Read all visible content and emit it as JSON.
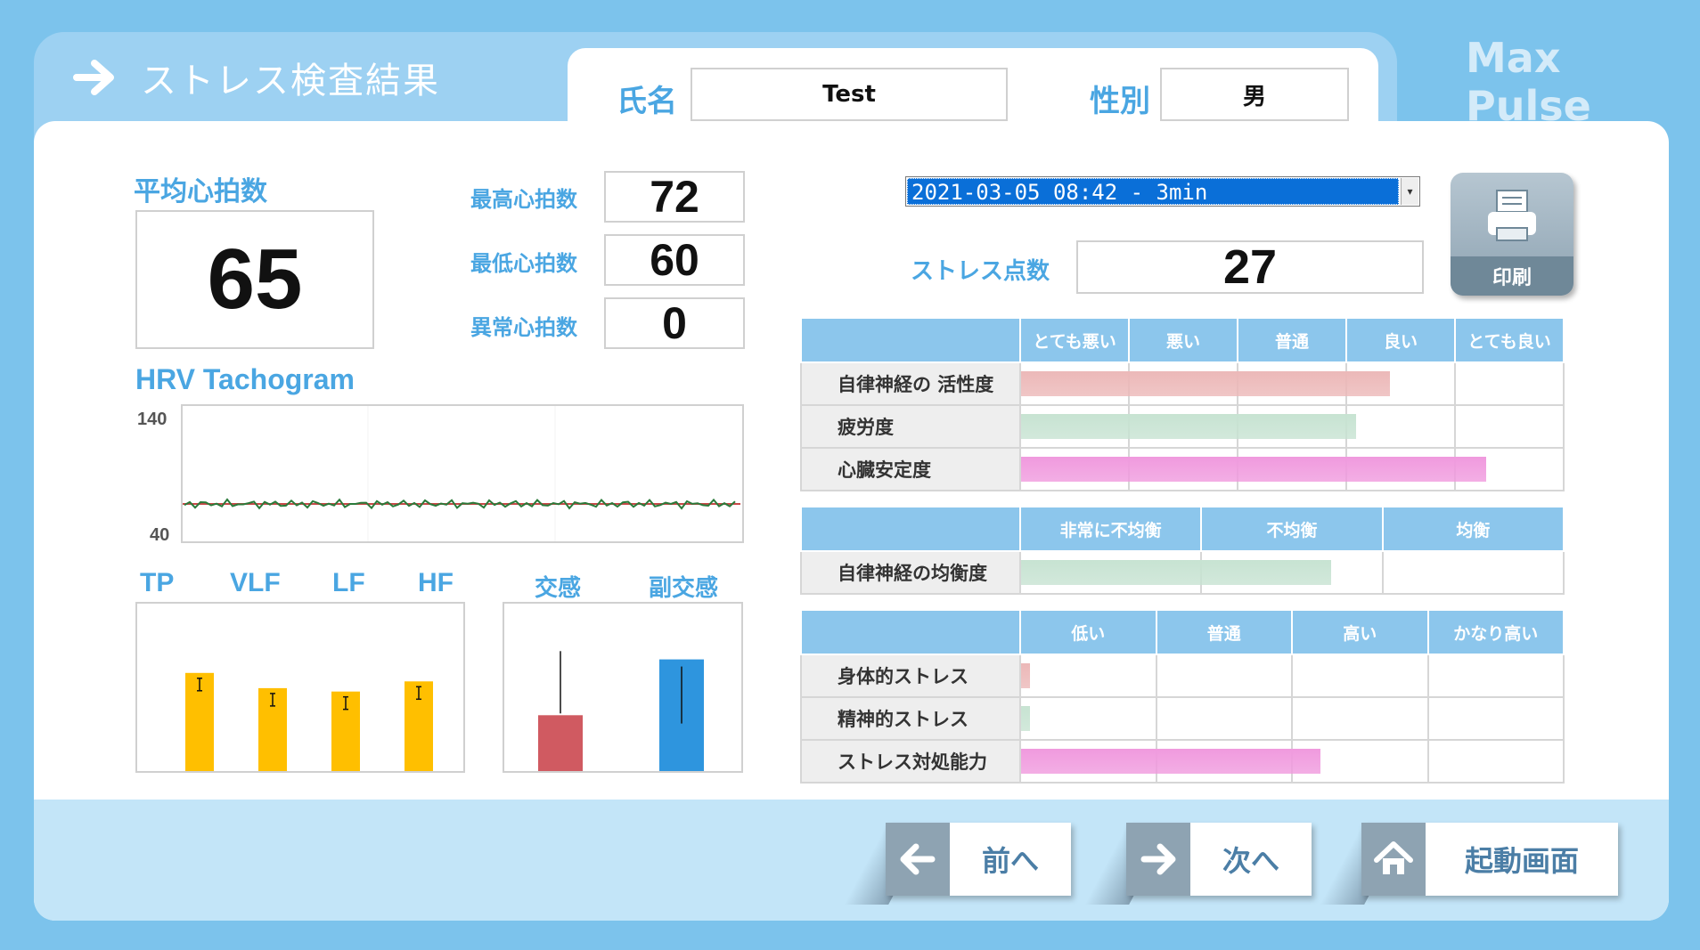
{
  "header": {
    "title": "ストレス検査結果",
    "brand": "Max Pulse"
  },
  "patient": {
    "name_label": "氏名",
    "name_value": "Test",
    "gender_label": "性別",
    "gender_value": "男"
  },
  "heart": {
    "avg_label": "平均心拍数",
    "avg_value": "65",
    "max_label": "最高心拍数",
    "max_value": "72",
    "min_label": "最低心拍数",
    "min_value": "60",
    "abnormal_label": "異常心拍数",
    "abnormal_value": "0"
  },
  "hrv": {
    "title": "HRV Tachogram",
    "y_max": "140",
    "y_min": "40"
  },
  "spectrum": {
    "labels": [
      "TP",
      "VLF",
      "LF",
      "HF"
    ],
    "values": [
      0.58,
      0.49,
      0.47,
      0.53
    ],
    "color": "#ffbf00"
  },
  "ans": {
    "labels": [
      "交感",
      "副交感"
    ],
    "values": [
      0.33,
      0.66
    ],
    "colors": [
      "#d05a61",
      "#2e95de"
    ]
  },
  "session": {
    "selected": "2021-03-05 08:42 - 3min"
  },
  "stress_score": {
    "label": "ストレス点数",
    "value": "27"
  },
  "print_label": "印刷",
  "table1": {
    "headers": [
      "とても悪い",
      "悪い",
      "普通",
      "良い",
      "とても良い"
    ],
    "rows": [
      {
        "label": "自律神経の 活性度",
        "value": 0.69,
        "color": "#ecb8b8"
      },
      {
        "label": "疲労度",
        "value": 0.626,
        "color": "#c7e3d2"
      },
      {
        "label": "心臓安定度",
        "value": 0.87,
        "color": "#f09ade"
      }
    ]
  },
  "table2": {
    "headers": [
      "非常に不均衡",
      "不均衡",
      "均衡"
    ],
    "rows": [
      {
        "label": "自律神経の均衡度",
        "value": 0.576,
        "color": "#c7e3d2"
      }
    ]
  },
  "table3": {
    "headers": [
      "低い",
      "普通",
      "高い",
      "かなり高い"
    ],
    "rows": [
      {
        "label": "身体的ストレス",
        "value": 0.016,
        "color": "#ecb8b8"
      },
      {
        "label": "精神的ストレス",
        "value": 0.016,
        "color": "#c7e3d2"
      },
      {
        "label": "ストレス対処能力",
        "value": 0.558,
        "color": "#f09ade"
      }
    ]
  },
  "nav": {
    "prev": "前へ",
    "next": "次へ",
    "home": "起動画面"
  }
}
